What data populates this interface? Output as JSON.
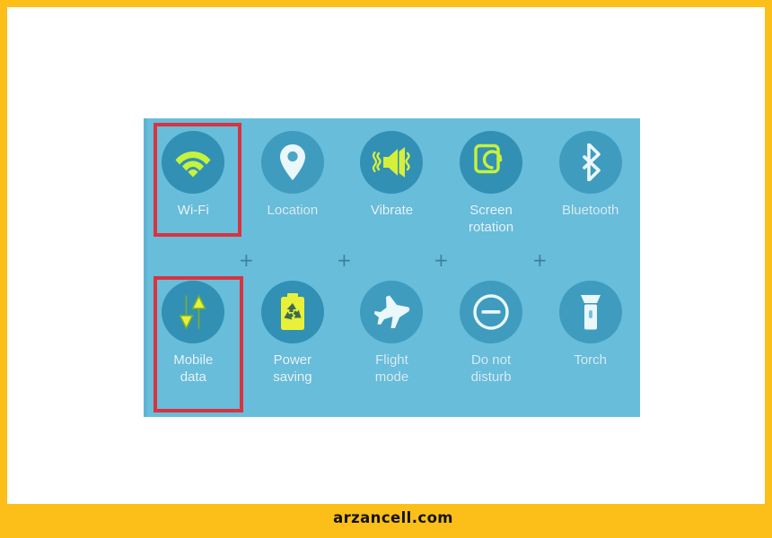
{
  "page": {
    "frame_color": "#fcbf1a",
    "background_color": "#ffffff"
  },
  "footer": {
    "watermark": "arzancell.com",
    "bar_color": "#fcbf1a",
    "text_color": "#141414"
  },
  "panel": {
    "background_color": "#68bdda",
    "tile_active_color": "#3190b4",
    "tile_inactive_color": "#3f9cbf",
    "label_color": "#e8f6fb",
    "accent_active_icon": "#c5f23c",
    "accent_inactive_icon": "#e9f7fb",
    "separator_symbol": "+",
    "separator_color": "#3c7f99",
    "separator_count": 4
  },
  "highlights": {
    "color": "#d8343f",
    "targets": [
      "Wi-Fi",
      "Mobile data"
    ]
  },
  "tiles": {
    "top_row": [
      {
        "label": "Wi-Fi",
        "icon": "wifi-icon",
        "state": "on"
      },
      {
        "label": "Location",
        "icon": "location-pin-icon",
        "state": "off"
      },
      {
        "label": "Vibrate",
        "icon": "vibrate-icon",
        "state": "on"
      },
      {
        "label": "Screen\nrotation",
        "icon": "screen-rotation-icon",
        "state": "on"
      },
      {
        "label": "Bluetooth",
        "icon": "bluetooth-icon",
        "state": "off"
      }
    ],
    "bottom_row": [
      {
        "label": "Mobile\ndata",
        "icon": "mobile-data-icon",
        "state": "on"
      },
      {
        "label": "Power\nsaving",
        "icon": "battery-recycle-icon",
        "state": "on"
      },
      {
        "label": "Flight\nmode",
        "icon": "airplane-icon",
        "state": "off"
      },
      {
        "label": "Do not\ndisturb",
        "icon": "do-not-disturb-icon",
        "state": "off"
      },
      {
        "label": "Torch",
        "icon": "flashlight-icon",
        "state": "off"
      }
    ]
  }
}
